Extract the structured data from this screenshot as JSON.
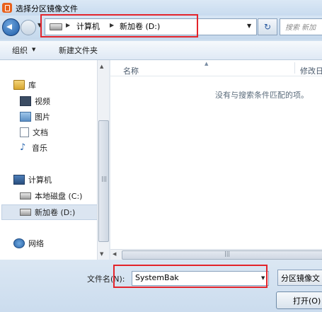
{
  "window": {
    "title": "选择分区镜像文件"
  },
  "address": {
    "separator": "▶",
    "computer": "计算机",
    "drive": "新加卷 (D:)",
    "dropdown": "▼",
    "history": "▼"
  },
  "search": {
    "placeholder": "搜索 新加"
  },
  "toolbar": {
    "organize": "组织",
    "organize_arrow": "▼",
    "new_folder": "新建文件夹"
  },
  "nav": {
    "library": "库",
    "video": "视频",
    "pictures": "图片",
    "docs": "文档",
    "music": "音乐",
    "computer": "计算机",
    "local_c": "本地磁盘 (C:)",
    "drive_d": "新加卷 (D:)",
    "network": "网络"
  },
  "content": {
    "col_name": "名称",
    "col_date": "修改日",
    "sort_arrow": "▲",
    "empty": "没有与搜索条件匹配的项。"
  },
  "scroll": {
    "up": "▲",
    "down": "▼",
    "left": "◀",
    "grip": "|||"
  },
  "form": {
    "filename_label": "文件名(N):",
    "filename_value": "SystemBak",
    "filename_dropdown": "▼",
    "filetype": "分区镜像文",
    "open": "打开(O)"
  },
  "icons": {
    "refresh": "↻",
    "music_note": "♪"
  },
  "colors": {
    "highlight": "#e3242b",
    "back_button": "#1c5aa6"
  }
}
